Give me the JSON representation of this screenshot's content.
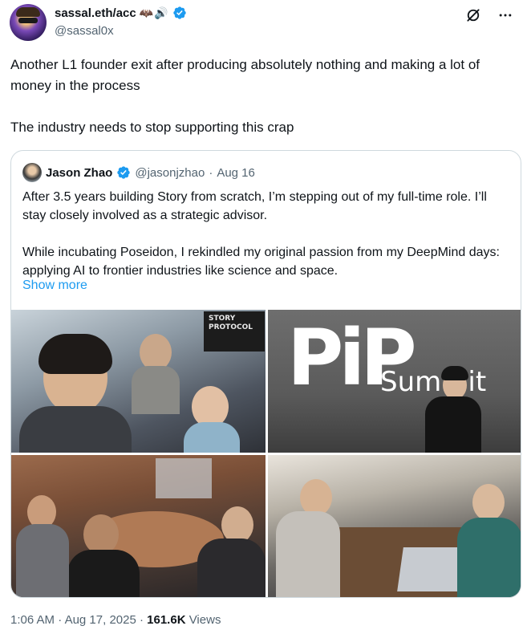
{
  "author": {
    "display_name": "sassal.eth/acc",
    "name_emoji": "🦇🔊",
    "handle": "@sassal0x"
  },
  "tweet": {
    "text": "Another L1 founder exit after producing absolutely nothing and making a lot of money in the process\n\nThe industry needs to stop supporting this crap"
  },
  "quote": {
    "display_name": "Jason Zhao",
    "handle": "@jasonjzhao",
    "separator": "·",
    "date": "Aug 16",
    "text": "After 3.5 years building Story from scratch, I’m stepping out of my full-time role. I’ll stay closely involved as a strategic advisor.\n\nWhile incubating Poseidon, I rekindled my original passion from my DeepMind days: applying AI to frontier industries like science and space.",
    "show_more": "Show more",
    "photos": {
      "p1_sign": "STORY\nPROTOCOL",
      "p2_logo": "PiP",
      "p2_word": "Summit"
    }
  },
  "footer": {
    "time": "1:06 AM",
    "sep1": " · ",
    "date": "Aug 17, 2025",
    "sep2": " · ",
    "views_count": "161.6K",
    "views_label": " Views"
  },
  "colors": {
    "verified": "#1d9bf0",
    "link": "#1d9bf0",
    "secondary_text": "#536471",
    "border": "#cfd9de"
  },
  "icons": [
    "verified-badge-icon",
    "grok-icon",
    "more-icon"
  ]
}
